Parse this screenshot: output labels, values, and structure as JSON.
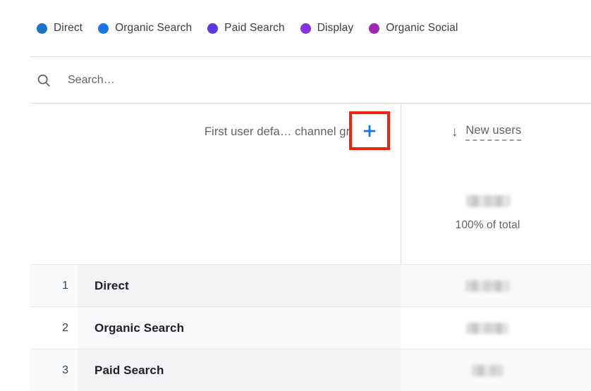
{
  "legend": {
    "items": [
      {
        "label": "Direct",
        "color": "#1a73c8"
      },
      {
        "label": "Organic Search",
        "color": "#1a73e8"
      },
      {
        "label": "Paid Search",
        "color": "#5c38e0"
      },
      {
        "label": "Display",
        "color": "#8433dc"
      },
      {
        "label": "Organic Social",
        "color": "#9c27b0"
      }
    ]
  },
  "search": {
    "placeholder": "Search…",
    "value": "",
    "icon": "search-icon"
  },
  "table": {
    "dimension_header": {
      "label": "First user defa… channel group",
      "caret_icon": "chevron-down-icon",
      "add_button_label": "+",
      "add_button_icon": "plus-icon",
      "highlight_color": "#f1230c",
      "accent_color": "#1a73e8"
    },
    "metric_header": {
      "sort_icon": "arrow-down-icon",
      "label": "New users"
    },
    "totals": {
      "value": "",
      "caption": "100% of total"
    },
    "rows": [
      {
        "index": "1",
        "name": "Direct",
        "value": ""
      },
      {
        "index": "2",
        "name": "Organic Search",
        "value": ""
      },
      {
        "index": "3",
        "name": "Paid Search",
        "value": ""
      }
    ]
  }
}
